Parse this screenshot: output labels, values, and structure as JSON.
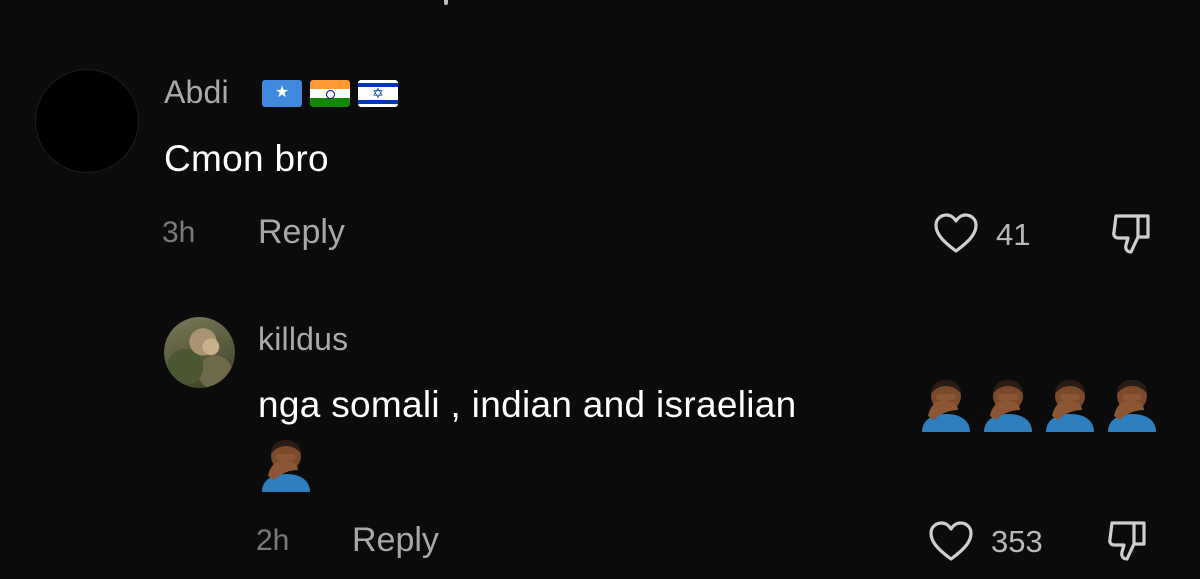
{
  "comments": [
    {
      "username": "Abdi",
      "flags": [
        "somalia-flag",
        "india-flag",
        "israel-flag"
      ],
      "text": "Cmon bro",
      "time": "3h",
      "reply_label": "Reply",
      "likes": "41"
    },
    {
      "username": "killdus",
      "text": "nga somali , indian and israelian",
      "emoji": "man-facepalming-medium-dark-skin-tone",
      "emoji_count": 5,
      "time": "2h",
      "reply_label": "Reply",
      "likes": "353"
    }
  ],
  "icons": {
    "like": "heart-outline-icon",
    "dislike": "thumbs-down-outline-icon"
  },
  "colors": {
    "background": "#0b0b0b",
    "username": "#aaaaaa",
    "text": "#ffffff",
    "muted": "#7a7a7a"
  }
}
